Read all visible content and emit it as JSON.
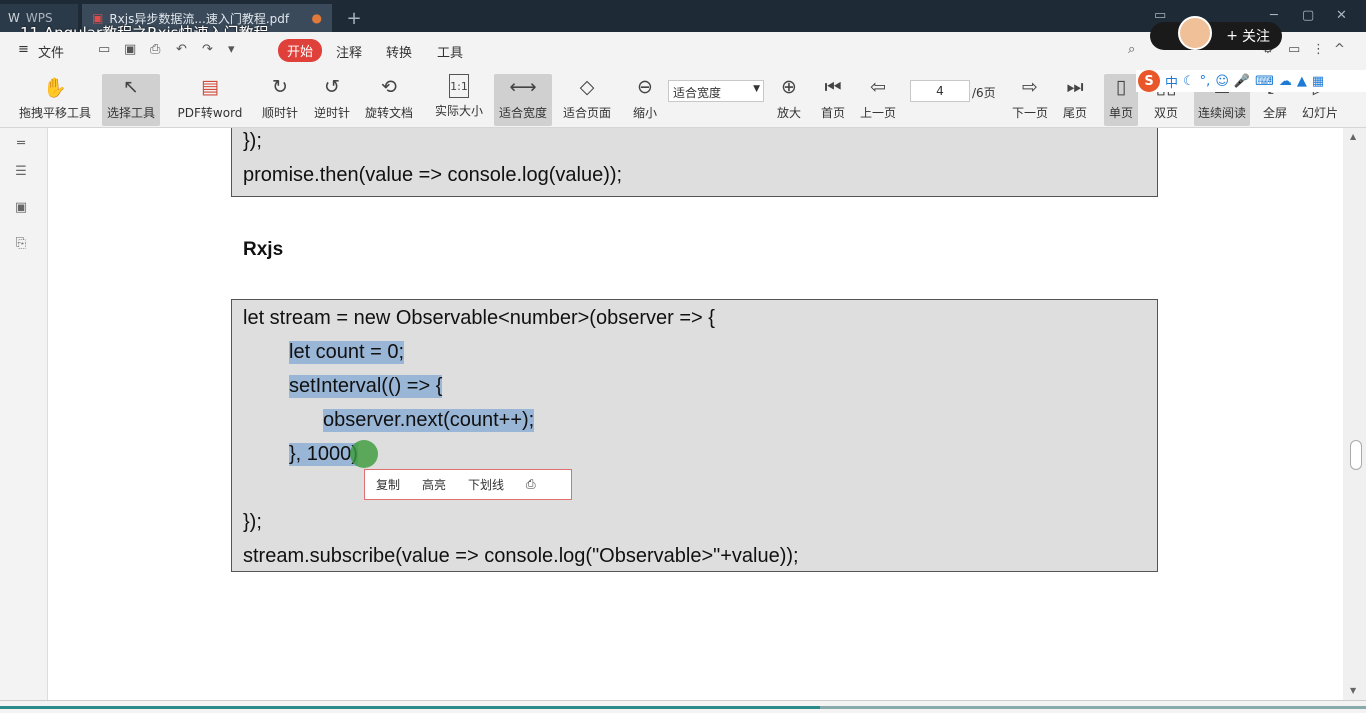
{
  "tabs": [
    {
      "label": "WPS",
      "icon": "wps-logo-icon"
    },
    {
      "label": "Rxjs异步数据流...速入门教程.pdf",
      "icon": "pdf-icon"
    }
  ],
  "video_title": "11 Angular教程之Rxjs快速入门教程",
  "menu": {
    "file": "文件",
    "items": [
      "开始",
      "注释",
      "转换",
      "工具"
    ],
    "active": "开始"
  },
  "follow": {
    "label": "关注",
    "plus": "+"
  },
  "toolbar": {
    "tools": [
      "拖拽平移工具",
      "选择工具",
      "PDF转word",
      "顺时针",
      "逆时针",
      "旋转文档",
      "实际大小",
      "适合宽度",
      "适合页面",
      "缩小",
      "放大",
      "首页",
      "上一页",
      "下一页",
      "尾页",
      "单页",
      "双页",
      "连续阅读",
      "全屏",
      "幻灯片"
    ],
    "zoom_value": "适合宽度",
    "page_value": "4",
    "page_total": "/6页"
  },
  "ime": {
    "items": [
      "中"
    ]
  },
  "document": {
    "top_lines": [
      "});",
      "promise.then(value => console.log(value));"
    ],
    "heading": "Rxjs",
    "code_lines": [
      "let stream = new Observable<number>(observer => {",
      "let count = 0;",
      "setInterval(() => {",
      "observer.next(count++);",
      "}, 1000)",
      "});",
      "stream.subscribe(value => console.log(\"Observable>\"+value));"
    ]
  },
  "context_menu": [
    "复制",
    "高亮",
    "下划线"
  ],
  "playback_progress": 0.6
}
